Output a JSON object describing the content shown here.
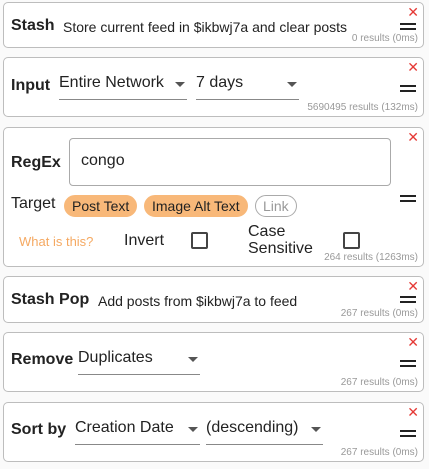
{
  "stash": {
    "title": "Stash",
    "description": "Store current feed in $ikbwj7a and clear posts",
    "results": "0 results (0ms)"
  },
  "input": {
    "title": "Input",
    "source_value": "Entire Network",
    "range_value": "7 days",
    "results": "5690495 results (132ms)"
  },
  "regex": {
    "title": "RegEx",
    "pattern_value": "congo",
    "target_label": "Target",
    "chips": [
      "Post Text",
      "Image Alt Text",
      "Link"
    ],
    "help_link": "What is this?",
    "invert_label": "Invert",
    "case_label_line1": "Case",
    "case_label_line2": "Sensitive",
    "results": "264 results (1263ms)"
  },
  "stash_pop": {
    "title": "Stash Pop",
    "description": "Add posts from $ikbwj7a to feed",
    "results": "267 results (0ms)"
  },
  "remove": {
    "title": "Remove",
    "value": "Duplicates",
    "results": "267 results (0ms)"
  },
  "sort": {
    "title": "Sort by",
    "field_value": "Creation Date",
    "order_value": "(descending)",
    "results": "267 results (0ms)"
  },
  "icons": {
    "close": "close-icon",
    "drag": "drag-handle-icon",
    "caret": "chevron-down-icon"
  },
  "colors": {
    "accent": "#f8b879",
    "close": "#e53935",
    "link": "#f5a962"
  }
}
